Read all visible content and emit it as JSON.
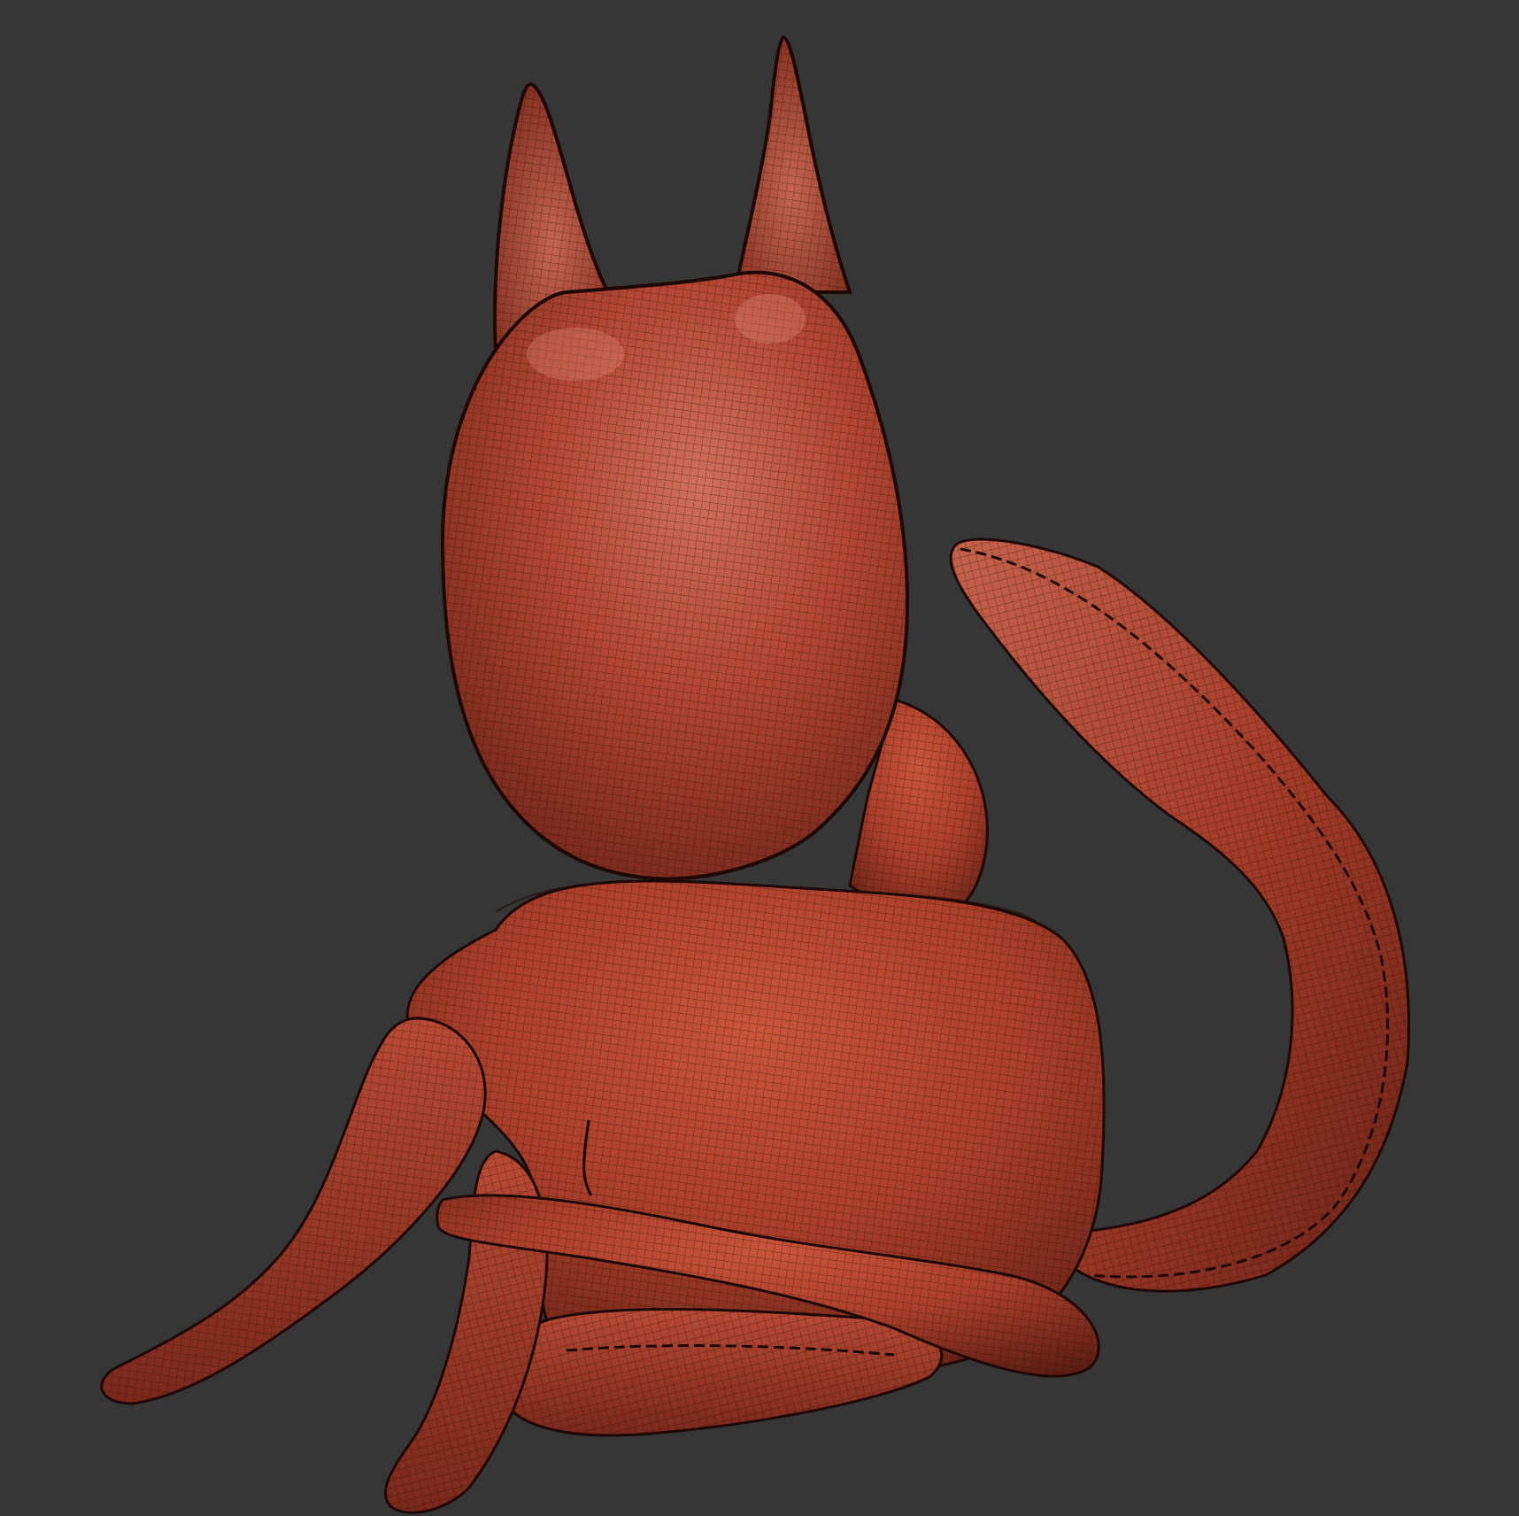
{
  "scene": {
    "background_color": "#363636",
    "mesh_base_color": "#b8452f",
    "mesh_shadow_color": "#6e2418",
    "mesh_highlight_color": "#e08a74",
    "wireframe_color": "#2a0c06",
    "outline_color": "#1e0804",
    "parts": [
      "head",
      "left-ear",
      "right-ear",
      "neck",
      "body",
      "tail",
      "front-left-leg",
      "front-right-leg",
      "hind-leg",
      "paw"
    ]
  }
}
